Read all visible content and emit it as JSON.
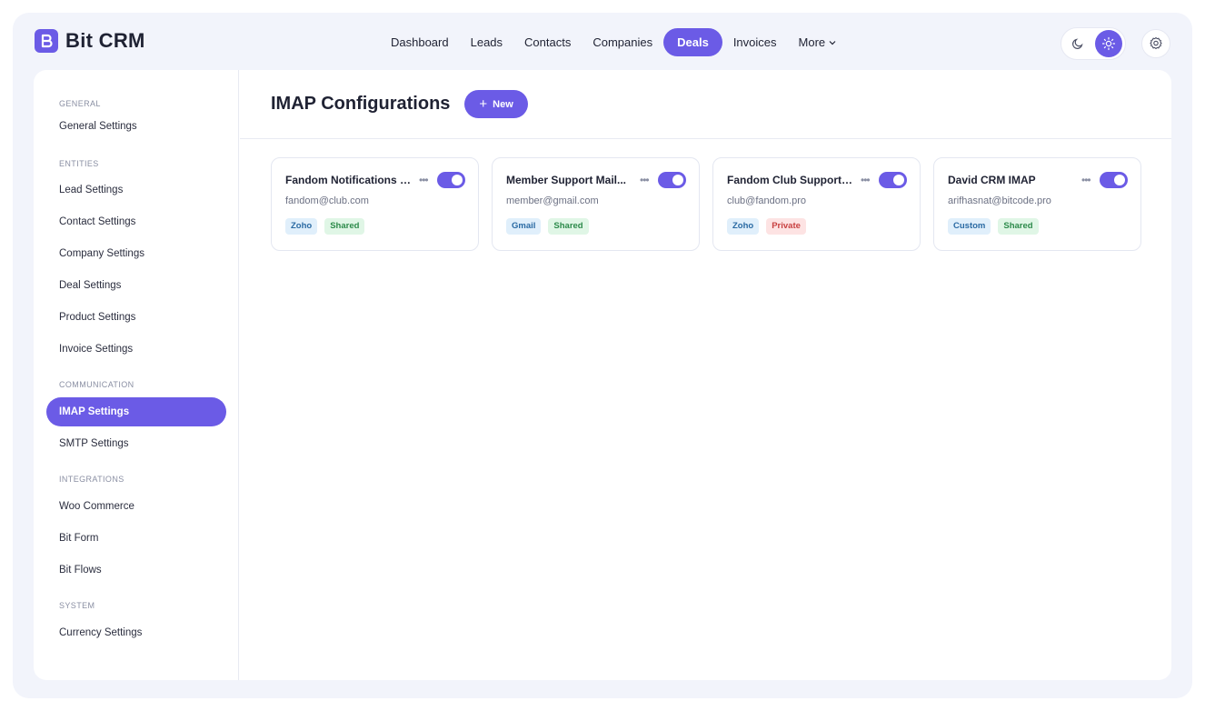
{
  "app": {
    "logo_text": "Bit CRM",
    "brand_color": "#6b5be6"
  },
  "topnav": {
    "items": [
      {
        "label": "Dashboard"
      },
      {
        "label": "Leads"
      },
      {
        "label": "Contacts"
      },
      {
        "label": "Companies"
      },
      {
        "label": "Deals",
        "active": true
      },
      {
        "label": "Invoices"
      },
      {
        "label": "More"
      }
    ]
  },
  "theme": {
    "dark_icon": "moon-icon",
    "light_icon": "sun-icon",
    "selected": "light"
  },
  "settings_icon": "gear-icon",
  "sidebar": {
    "sections": [
      {
        "title": "GENERAL",
        "items": [
          {
            "label": "General Settings"
          }
        ]
      },
      {
        "title": "ENTITIES",
        "items": [
          {
            "label": "Lead Settings"
          },
          {
            "label": "Contact Settings"
          },
          {
            "label": "Company Settings"
          },
          {
            "label": "Deal Settings"
          },
          {
            "label": "Product Settings"
          },
          {
            "label": "Invoice Settings"
          }
        ]
      },
      {
        "title": "COMMUNICATION",
        "items": [
          {
            "label": "IMAP Settings",
            "active": true
          },
          {
            "label": "SMTP Settings"
          }
        ]
      },
      {
        "title": "INTEGRATIONS",
        "items": [
          {
            "label": "Woo Commerce"
          },
          {
            "label": "Bit Form"
          },
          {
            "label": "Bit Flows"
          }
        ]
      },
      {
        "title": "SYSTEM",
        "items": [
          {
            "label": "Currency Settings"
          }
        ]
      }
    ]
  },
  "main": {
    "title": "IMAP Configurations",
    "new_button": "New",
    "cards": [
      {
        "title": "Fandom Notifications I...",
        "email": "fandom@club.com",
        "enabled": true,
        "tags": [
          {
            "label": "Zoho",
            "color": "blue"
          },
          {
            "label": "Shared",
            "color": "green"
          }
        ]
      },
      {
        "title": "Member Support Mail...",
        "email": "member@gmail.com",
        "enabled": true,
        "tags": [
          {
            "label": "Gmail",
            "color": "blue"
          },
          {
            "label": "Shared",
            "color": "green"
          }
        ]
      },
      {
        "title": "Fandom Club Support I...",
        "email": "club@fandom.pro",
        "enabled": true,
        "tags": [
          {
            "label": "Zoho",
            "color": "blue"
          },
          {
            "label": "Private",
            "color": "red"
          }
        ]
      },
      {
        "title": "David CRM IMAP",
        "email": "arifhasnat@bitcode.pro",
        "enabled": true,
        "tags": [
          {
            "label": "Custom",
            "color": "blue"
          },
          {
            "label": "Shared",
            "color": "green"
          }
        ]
      }
    ]
  }
}
